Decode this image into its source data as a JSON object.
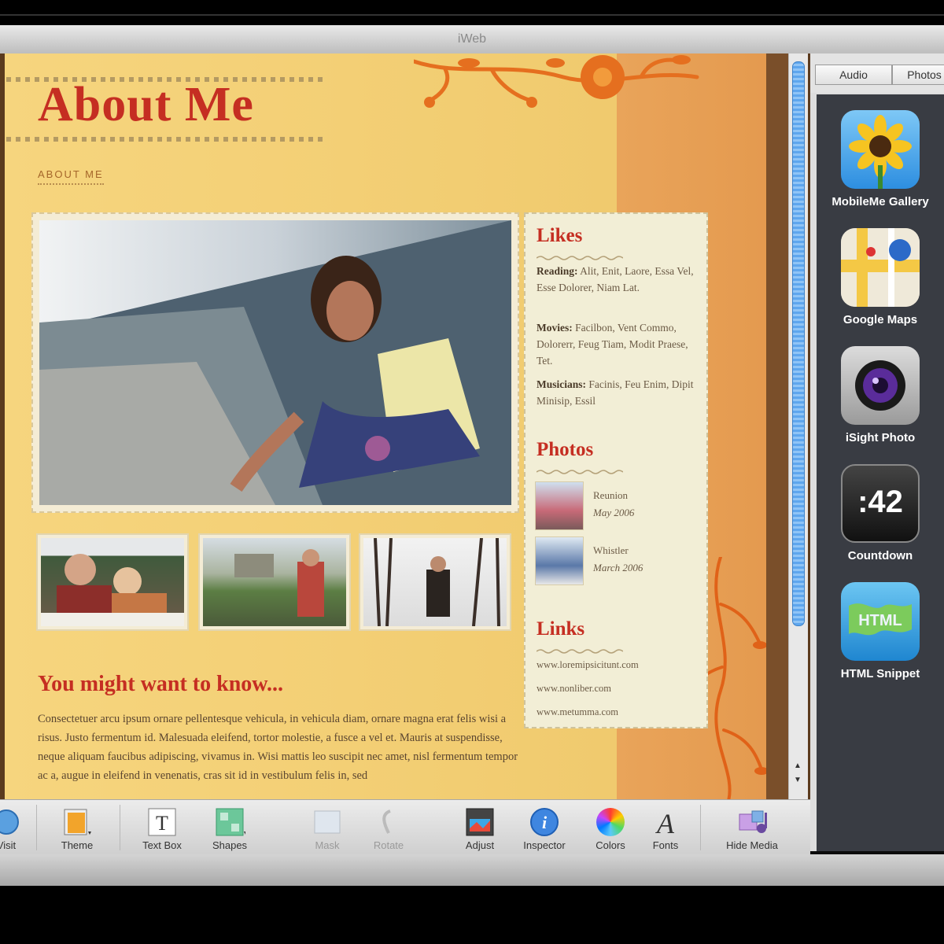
{
  "window": {
    "title": "iWeb"
  },
  "page": {
    "title": "About Me",
    "nav_link": "ABOUT ME",
    "know_title": "You might want to know...",
    "know_body": "Consectetuer arcu ipsum ornare pellentesque vehicula, in vehicula diam, ornare magna erat felis wisi a risus. Justo fermentum id. Malesuada eleifend, tortor molestie, a fusce a vel et. Mauris at suspendisse, neque aliquam faucibus adipiscing, vivamus in. Wisi mattis leo suscipit nec amet, nisl fermentum tempor ac a, augue in eleifend in venenatis, cras sit id in vestibulum felis in, sed"
  },
  "sidebar": {
    "likes_title": "Likes",
    "likes": [
      {
        "label": "Reading:",
        "text": "Alit, Enit, Laore, Essa Vel, Esse Dolorer, Niam Lat."
      },
      {
        "label": "Movies:",
        "text": "Facilbon, Vent Commo, Dolorerr, Feug Tiam, Modit Praese, Tet."
      },
      {
        "label": "Musicians:",
        "text": "Facinis, Feu Enim, Dipit Minisip, Essil"
      }
    ],
    "photos_title": "Photos",
    "photos": [
      {
        "name": "Reunion",
        "date": "May 2006"
      },
      {
        "name": "Whistler",
        "date": "March 2006"
      }
    ],
    "links_title": "Links",
    "links": [
      "www.loremipsicitunt.com",
      "www.nonliber.com",
      "www.metumma.com"
    ]
  },
  "media": {
    "tabs": [
      "Audio",
      "Photos"
    ],
    "widgets": [
      {
        "label": "MobileMe Gallery",
        "icon": "sunflower-gallery-icon"
      },
      {
        "label": "Google Maps",
        "icon": "google-maps-icon"
      },
      {
        "label": "iSight Photo",
        "icon": "camera-lens-icon"
      },
      {
        "label": "Countdown",
        "icon": "countdown-clock-icon",
        "value": ":42"
      },
      {
        "label": "HTML Snippet",
        "icon": "html-globe-icon",
        "value": "HTML"
      }
    ]
  },
  "toolbar": {
    "items": [
      {
        "label": "Visit",
        "icon": "visit-icon",
        "enabled": true
      },
      {
        "label": "Theme",
        "icon": "theme-icon",
        "enabled": true
      },
      {
        "label": "Text Box",
        "icon": "text-box-icon",
        "enabled": true
      },
      {
        "label": "Shapes",
        "icon": "shapes-icon",
        "enabled": true
      },
      {
        "label": "Mask",
        "icon": "mask-icon",
        "enabled": false
      },
      {
        "label": "Rotate",
        "icon": "rotate-icon",
        "enabled": false
      },
      {
        "label": "Adjust",
        "icon": "adjust-icon",
        "enabled": true
      },
      {
        "label": "Inspector",
        "icon": "inspector-icon",
        "enabled": true
      },
      {
        "label": "Colors",
        "icon": "colors-icon",
        "enabled": true
      },
      {
        "label": "Fonts",
        "icon": "fonts-icon",
        "enabled": true
      },
      {
        "label": "Hide Media",
        "icon": "hide-media-icon",
        "enabled": true
      }
    ]
  },
  "colors": {
    "accent_red": "#c52e22",
    "page_yellow": "#f4d27a",
    "band_orange": "#e8a055",
    "media_panel": "#393c43"
  }
}
